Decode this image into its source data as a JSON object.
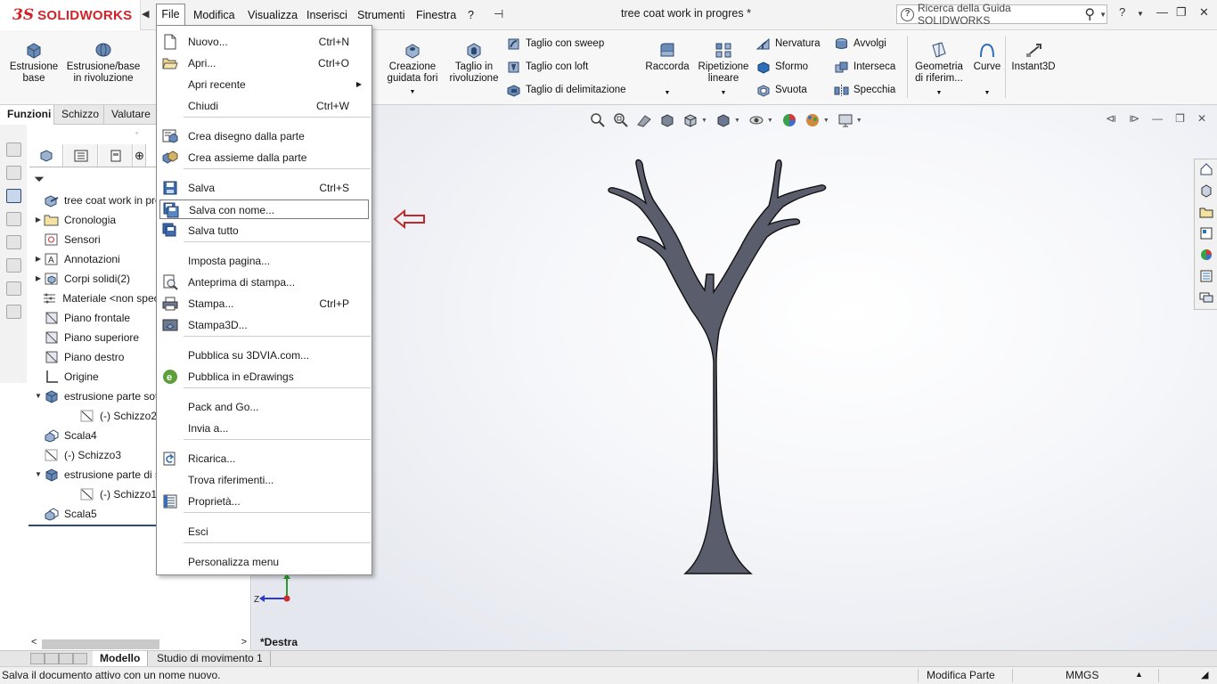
{
  "app": {
    "logo_prefix": "3S",
    "logo_text": "SOLIDWORKS",
    "document_title": "tree coat work in progres *",
    "brand_color": "#d2232a"
  },
  "menubar": {
    "items": [
      "File",
      "Modifica",
      "Visualizza",
      "Inserisci",
      "Strumenti",
      "Finestra",
      "?"
    ]
  },
  "help_search": {
    "placeholder": "Ricerca della Guida SOLIDWORKS"
  },
  "ribbon": {
    "big": [
      {
        "label": "Estrusione base",
        "icon": "extruded-boss-icon"
      },
      {
        "label": "Estrusione/base in rivoluzione",
        "icon": "revolved-boss-icon"
      },
      {
        "label": "Creazione guidata fori",
        "icon": "hole-wizard-icon"
      },
      {
        "label": "Taglio in rivoluzione",
        "icon": "revolved-cut-icon"
      },
      {
        "label": "Raccorda",
        "icon": "fillet-icon"
      },
      {
        "label": "Ripetizione lineare",
        "icon": "linear-pattern-icon"
      },
      {
        "label": "Geometria di riferim...",
        "icon": "reference-geometry-icon"
      },
      {
        "label": "Curve",
        "icon": "curves-icon"
      },
      {
        "label": "Instant3D",
        "icon": "instant3d-icon"
      }
    ],
    "small": [
      {
        "label": "Taglio con sweep",
        "icon": "swept-cut-icon"
      },
      {
        "label": "Taglio con loft",
        "icon": "lofted-cut-icon"
      },
      {
        "label": "Taglio di delimitazione",
        "icon": "boundary-cut-icon"
      },
      {
        "label": "Nervatura",
        "icon": "rib-icon"
      },
      {
        "label": "Sformo",
        "icon": "draft-icon"
      },
      {
        "label": "Svuota",
        "icon": "shell-icon"
      },
      {
        "label": "Avvolgi",
        "icon": "wrap-icon"
      },
      {
        "label": "Interseca",
        "icon": "intersect-icon"
      },
      {
        "label": "Specchia",
        "icon": "mirror-icon"
      }
    ]
  },
  "command_tabs": [
    "Funzioni",
    "Schizzo",
    "Valutare"
  ],
  "feature_tree": {
    "items": [
      {
        "label": "tree coat work in progres",
        "icon": "part-icon",
        "expander": ""
      },
      {
        "label": "Cronologia",
        "icon": "history-folder-icon",
        "expander": "▶"
      },
      {
        "label": "Sensori",
        "icon": "sensor-icon",
        "expander": ""
      },
      {
        "label": "Annotazioni",
        "icon": "annotations-icon",
        "expander": "▶"
      },
      {
        "label": "Corpi solidi(2)",
        "icon": "solid-bodies-icon",
        "expander": "▶"
      },
      {
        "label": "Materiale <non specificato>",
        "icon": "material-icon",
        "expander": ""
      },
      {
        "label": "Piano frontale",
        "icon": "plane-icon",
        "expander": ""
      },
      {
        "label": "Piano superiore",
        "icon": "plane-icon",
        "expander": ""
      },
      {
        "label": "Piano destro",
        "icon": "plane-icon",
        "expander": ""
      },
      {
        "label": "Origine",
        "icon": "origin-icon",
        "expander": ""
      },
      {
        "label": "estrusione parte sotto",
        "icon": "extrude-feature-icon",
        "expander": "▼"
      },
      {
        "label": "(-) Schizzo2",
        "icon": "sketch-icon",
        "expander": ""
      },
      {
        "label": "Scala4",
        "icon": "scale-feature-icon",
        "expander": ""
      },
      {
        "label": "(-) Schizzo3",
        "icon": "sketch-icon",
        "expander": ""
      },
      {
        "label": "estrusione parte di sopra",
        "icon": "extrude-feature-icon",
        "expander": "▼"
      },
      {
        "label": "(-) Schizzo1",
        "icon": "sketch-icon",
        "expander": ""
      },
      {
        "label": "Scala5",
        "icon": "scale-feature-icon",
        "expander": ""
      }
    ]
  },
  "file_menu": {
    "items": [
      {
        "label": "Nuovo...",
        "shortcut": "Ctrl+N",
        "icon": "new-document-icon"
      },
      {
        "label": "Apri...",
        "shortcut": "Ctrl+O",
        "icon": "open-folder-icon"
      },
      {
        "label": "Apri recente",
        "shortcut": "",
        "icon": "",
        "submenu": "▶"
      },
      {
        "label": "Chiudi",
        "shortcut": "Ctrl+W",
        "icon": ""
      },
      {
        "label": "Crea disegno dalla parte",
        "shortcut": "",
        "icon": "make-drawing-icon"
      },
      {
        "label": "Crea assieme dalla parte",
        "shortcut": "",
        "icon": "make-assembly-icon"
      },
      {
        "label": "Salva",
        "shortcut": "Ctrl+S",
        "icon": "save-icon"
      },
      {
        "label": "Salva con nome...",
        "shortcut": "",
        "icon": "save-as-icon"
      },
      {
        "label": "Salva tutto",
        "shortcut": "",
        "icon": "save-all-icon"
      },
      {
        "label": "Imposta pagina...",
        "shortcut": "",
        "icon": ""
      },
      {
        "label": "Anteprima di stampa...",
        "shortcut": "",
        "icon": "print-preview-icon"
      },
      {
        "label": "Stampa...",
        "shortcut": "Ctrl+P",
        "icon": "print-icon"
      },
      {
        "label": "Stampa3D...",
        "shortcut": "",
        "icon": "print3d-icon"
      },
      {
        "label": "Pubblica su 3DVIA.com...",
        "shortcut": "",
        "icon": ""
      },
      {
        "label": "Pubblica in eDrawings",
        "shortcut": "",
        "icon": "edrawings-icon"
      },
      {
        "label": "Pack and Go...",
        "shortcut": "",
        "icon": ""
      },
      {
        "label": "Invia a...",
        "shortcut": "",
        "icon": ""
      },
      {
        "label": "Ricarica...",
        "shortcut": "",
        "icon": "reload-icon"
      },
      {
        "label": "Trova riferimenti...",
        "shortcut": "",
        "icon": ""
      },
      {
        "label": "Proprietà...",
        "shortcut": "",
        "icon": "properties-icon"
      },
      {
        "label": "Esci",
        "shortcut": "",
        "icon": ""
      },
      {
        "label": "Personalizza menu",
        "shortcut": "",
        "icon": ""
      }
    ],
    "highlighted": "Salva con nome..."
  },
  "graphics": {
    "view_name": "*Destra",
    "model_color": "#5a5e6c",
    "annotation_arrow_color": "#c0282d"
  },
  "bottom_tabs": [
    "Modello",
    "Studio di movimento 1"
  ],
  "status_bar": {
    "message": "Salva il documento attivo con un nome nuovo.",
    "mode": "Modifica Parte",
    "units": "MMGS"
  }
}
